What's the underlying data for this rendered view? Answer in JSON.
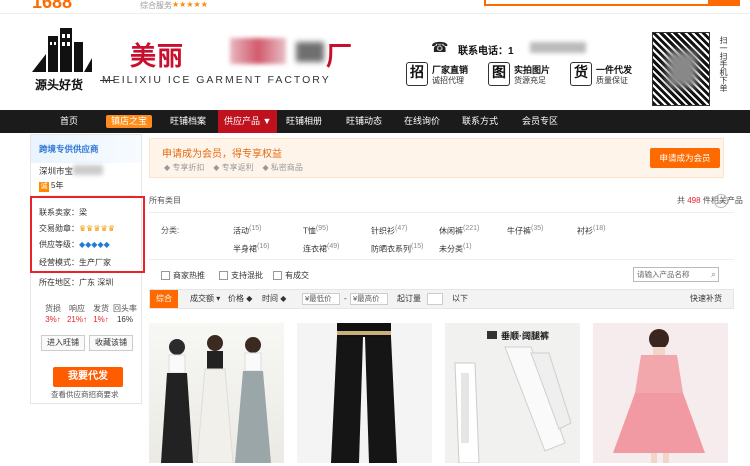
{
  "topbar": {
    "brand": "1688",
    "rating_label": "综合服务",
    "stars": "★★★★★"
  },
  "header": {
    "logo_subtitle": "源头好货",
    "shop_name_prefix": "美丽",
    "shop_name_suffix": "厂",
    "shop_name_en": "MEILIXIU ICE GARMENT FACTORY",
    "phone_label": "联系电话：1",
    "features": [
      {
        "badge": "招",
        "title": "厂家直销",
        "subtitle": "诚招代理"
      },
      {
        "badge": "图",
        "title": "实拍图片",
        "subtitle": "货源充足"
      },
      {
        "badge": "货",
        "title": "一件代发",
        "subtitle": "质量保证"
      }
    ],
    "qr_text": "扫一扫手机下单"
  },
  "nav": {
    "items": [
      "首页",
      "镇店之宝",
      "旺铺档案",
      "供应产品 ▼",
      "旺铺相册",
      "旺铺动态",
      "在线询价",
      "联系方式",
      "会员专区"
    ]
  },
  "sidebar": {
    "head": "跨境专供供应商",
    "region": "深圳市宝",
    "years": "5年",
    "year_icon": "诚",
    "contact_label": "联系卖家：梁",
    "trade_label": "交易勋章：",
    "trade_icons": "♛♛♛♛♛",
    "supply_label": "供应等级：",
    "supply_icons": "◆◆◆◆◆",
    "mode_label": "经营模式：生产厂家",
    "location": "所在地区：广东 深圳",
    "stats_headers": [
      "货损",
      "响应",
      "发货",
      "回头率"
    ],
    "stats_values": [
      "3%↑",
      "21%↑",
      "1%↑",
      "16%"
    ],
    "enter_shop": "进入旺铺",
    "favorite_shop": "收藏该铺",
    "agent_button": "我要代发",
    "agent_note": "查看供应商招商要求"
  },
  "member": {
    "title": "申请成为会员，得专享权益",
    "perks": [
      "专享折扣",
      "专享返利",
      "私密商品"
    ],
    "button": "申请成为会员"
  },
  "category": {
    "all_label": "所有类目",
    "total_prefix": "共",
    "total_count": "498",
    "total_suffix": "件相关产品",
    "label": "分类:",
    "items": [
      {
        "name": "活动",
        "count": "(15)"
      },
      {
        "name": "T恤",
        "count": "(95)"
      },
      {
        "name": "针织衫",
        "count": "(47)"
      },
      {
        "name": "休闲裤",
        "count": "(221)"
      },
      {
        "name": "牛仔裤",
        "count": "(35)"
      },
      {
        "name": "衬衫",
        "count": "(18)"
      },
      {
        "name": "半身裙",
        "count": "(16)"
      },
      {
        "name": "连衣裙",
        "count": "(49)"
      },
      {
        "name": "防晒衣系列",
        "count": "(15)"
      },
      {
        "name": "未分类",
        "count": "(1)"
      }
    ]
  },
  "filters": {
    "hot": "商家热推",
    "mixed": "支持混批",
    "has_stock": "有成交",
    "search_placeholder": "请输入产品名称"
  },
  "sortbar": {
    "overall": "综合",
    "volume": "成交额 ▾",
    "price": "价格 ◆",
    "time": "时间 ◆",
    "min_price": "¥最低价",
    "dash": "-",
    "max_price": "¥最高价",
    "min_order": "起订量",
    "below": "以下",
    "dropship": "快速补货"
  },
  "products": {
    "banner3": "垂顺·阔腿裤"
  }
}
